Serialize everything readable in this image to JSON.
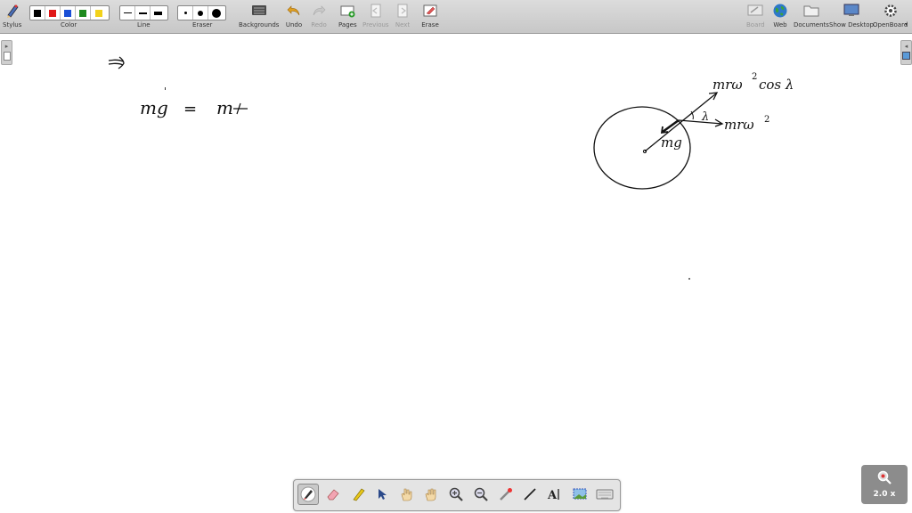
{
  "toolbar": {
    "stylus_label": "Stylus",
    "color_label": "Color",
    "line_label": "Line",
    "eraser_label": "Eraser",
    "backgrounds_label": "Backgrounds",
    "undo_label": "Undo",
    "redo_label": "Redo",
    "pages_label": "Pages",
    "previous_label": "Previous",
    "next_label": "Next",
    "erase_label": "Erase",
    "board_label": "Board",
    "web_label": "Web",
    "documents_label": "Documents",
    "show_desktop_label": "Show Desktop",
    "openboard_label": "OpenBoard",
    "colors": [
      "#000000",
      "#e01818",
      "#1a4fd6",
      "#1e8a1e",
      "#f2d21b"
    ]
  },
  "zoom": {
    "label": "2.0 x"
  },
  "board": {
    "equation_left": "mg",
    "equation_prime": "'",
    "equation_equals": "=",
    "equation_right": "m",
    "label_mrw2cos": "mrω",
    "label_cos": "cos λ",
    "label_mrw2": "mrω",
    "label_mg": "mg",
    "label_lambda": "λ",
    "sup_2": "2",
    "implies": "⇒"
  },
  "dock": {
    "tools": [
      "pen-icon",
      "eraser-icon",
      "highlighter-icon",
      "select-arrow-icon",
      "interact-hand-icon",
      "pan-hand-icon",
      "zoom-in-icon",
      "zoom-out-icon",
      "laser-pointer-icon",
      "line-icon",
      "text-icon",
      "capture-icon",
      "virtual-keyboard-icon"
    ]
  }
}
